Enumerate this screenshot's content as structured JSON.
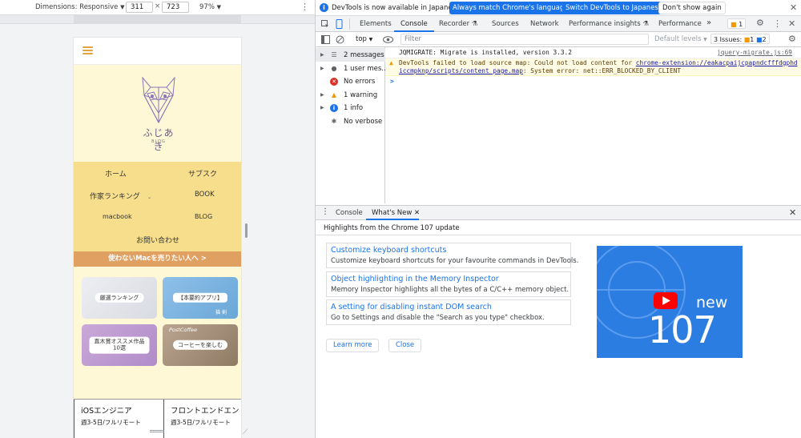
{
  "device_toolbar": {
    "dimensions_label": "Dimensions: Responsive",
    "width": "311",
    "times": "×",
    "height": "723",
    "zoom": "97%"
  },
  "site": {
    "logo_text": "ふじあき",
    "logo_sub": "BLOG",
    "nav": [
      "ホーム",
      "サブスク",
      "作家ランキング",
      "BOOK",
      "macbook",
      "BLOG",
      "お問い合わせ"
    ],
    "sell_banner": "使わないMacを売りたい人へ >",
    "cards": [
      {
        "label": "厳選ランキング"
      },
      {
        "label": "【本要約アプリ】",
        "sub": "猫 剣"
      },
      {
        "label": "直木賞オススメ作品\n10選"
      },
      {
        "label": "コーヒーを楽しむ",
        "sub": "PostCoffee"
      }
    ],
    "jobs": [
      {
        "title": "iOSエンジニア",
        "sub": "週3-5日/フルリモート"
      },
      {
        "title": "フロントエンドエン",
        "sub": "週3-5日/フルリモート"
      }
    ]
  },
  "devtools": {
    "infobar": {
      "message": "DevTools is now available in Japanese!",
      "btn_match": "Always match Chrome's language",
      "btn_switch": "Switch DevTools to Japanese",
      "btn_dismiss": "Don't show again"
    },
    "tabs": [
      "Elements",
      "Console",
      "Recorder",
      "Sources",
      "Network",
      "Performance insights",
      "Performance"
    ],
    "more": "»",
    "badge_count": "1",
    "toolbar": {
      "context": "top",
      "filter_placeholder": "Filter",
      "levels": "Default levels",
      "issues_label": "3 Issues:",
      "issues_warn": "1",
      "issues_info": "2"
    },
    "sidebar": [
      {
        "label": "2 messages",
        "icon": "list-icon"
      },
      {
        "label": "1 user mes...",
        "icon": "user-icon"
      },
      {
        "label": "No errors",
        "icon": "error-icon"
      },
      {
        "label": "1 warning",
        "icon": "warning-icon"
      },
      {
        "label": "1 info",
        "icon": "info-icon"
      },
      {
        "label": "No verbose",
        "icon": "verbose-icon"
      }
    ],
    "console": {
      "line1": "JQMIGRATE: Migrate is installed, version 3.3.2",
      "line1_src": "jquery-migrate.js:69",
      "line2_a": "DevTools failed to load source map: Could not load content for ",
      "line2_link1": "chrome-extension://eakacpaijcpapndcfffdgphd",
      "line2_link2": "iccmpknp/scripts/content_page.map",
      "line2_b": ": System error: net::ERR_BLOCKED_BY_CLIENT",
      "prompt": ">"
    },
    "drawer": {
      "tab_console": "Console",
      "tab_whatsnew": "What's New",
      "highlights": "Highlights from the Chrome 107 update",
      "features": [
        {
          "title": "Customize keyboard shortcuts",
          "desc": "Customize keyboard shortcuts for your favourite commands in DevTools."
        },
        {
          "title": "Object highlighting in the Memory Inspector",
          "desc": "Memory Inspector highlights all the bytes of a C/C++ memory object."
        },
        {
          "title": "A setting for disabling instant DOM search",
          "desc": "Go to Settings and disable the \"Search as you type\" checkbox."
        }
      ],
      "learn_more": "Learn more",
      "close": "Close",
      "video_new": "new",
      "video_version": "107"
    },
    "colors": {
      "accent": "#1a73e8",
      "warning_bg": "#fffbe5",
      "nav_bg": "#f6de8d",
      "page_bg": "#fff8d6"
    }
  }
}
